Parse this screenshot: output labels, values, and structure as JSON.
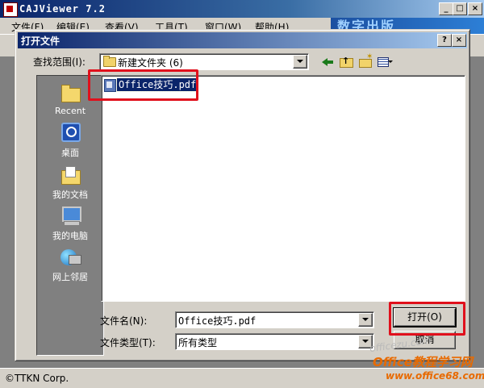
{
  "app": {
    "title": "CAJViewer 7.2",
    "window_buttons": {
      "minimize": "_",
      "maximize": "□",
      "close": "×"
    },
    "menu": [
      "文件(F)",
      "编辑(E)",
      "查看(V)",
      "工具(T)",
      "窗口(W)",
      "帮助(H)"
    ],
    "banner_text": "数字出版"
  },
  "dialog": {
    "title": "打开文件",
    "help_button": "?",
    "close_button": "×",
    "look_in_label": "查找范围(I):",
    "look_in_value": "新建文件夹 (6)",
    "places": [
      {
        "label": "Recent",
        "icon": "recent-folder-icon"
      },
      {
        "label": "桌面",
        "icon": "desktop-icon"
      },
      {
        "label": "我的文档",
        "icon": "my-documents-icon"
      },
      {
        "label": "我的电脑",
        "icon": "my-computer-icon"
      },
      {
        "label": "网上邻居",
        "icon": "network-icon"
      }
    ],
    "files": [
      {
        "name": "Office技巧.pdf",
        "icon": "pdf-file-icon",
        "selected": true
      }
    ],
    "file_name_label": "文件名(N):",
    "file_name_value": "Office技巧.pdf",
    "file_type_label": "文件类型(T):",
    "file_type_value": "所有类型",
    "open_button": "打开(O)",
    "cancel_button": "取消"
  },
  "statusbar": {
    "text": "©TTKN Corp."
  },
  "watermark": {
    "site": "officezu.com",
    "brand": "Office教程学习网",
    "url": "www.office68.com"
  },
  "colors": {
    "titlebar_start": "#0a246a",
    "titlebar_end": "#a6caf0",
    "dialog_face": "#d4d0c8",
    "highlight_annotation": "#e0101c",
    "selection": "#0a246a"
  }
}
